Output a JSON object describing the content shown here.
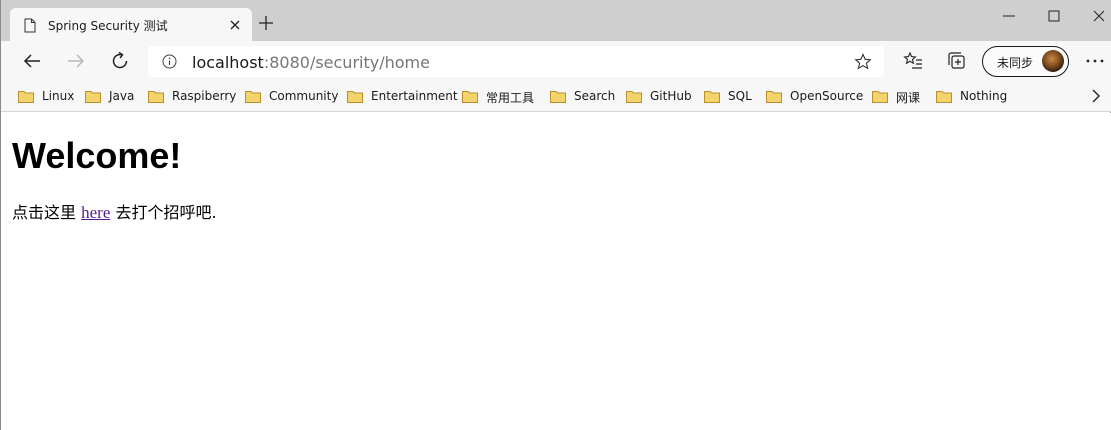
{
  "tab": {
    "title": "Spring Security 测试"
  },
  "address": {
    "host": "localhost",
    "path": ":8080/security/home"
  },
  "profile": {
    "label": "未同步"
  },
  "bookmarks": [
    {
      "label": "Linux"
    },
    {
      "label": "Java"
    },
    {
      "label": "Raspiberry"
    },
    {
      "label": "Community"
    },
    {
      "label": "Entertainment"
    },
    {
      "label": "常用工具"
    },
    {
      "label": "Search"
    },
    {
      "label": "GitHub"
    },
    {
      "label": "SQL"
    },
    {
      "label": "OpenSource"
    },
    {
      "label": "网课"
    },
    {
      "label": "Nothing"
    }
  ],
  "page": {
    "heading": "Welcome!",
    "text_before": "点击这里",
    "link": "here",
    "text_after": "去打个招呼吧."
  },
  "colors": {
    "link": "#551a8b",
    "titlebar": "#cfcfcf",
    "toolbar": "#f7f7f7",
    "folder": "#e8c34a"
  }
}
